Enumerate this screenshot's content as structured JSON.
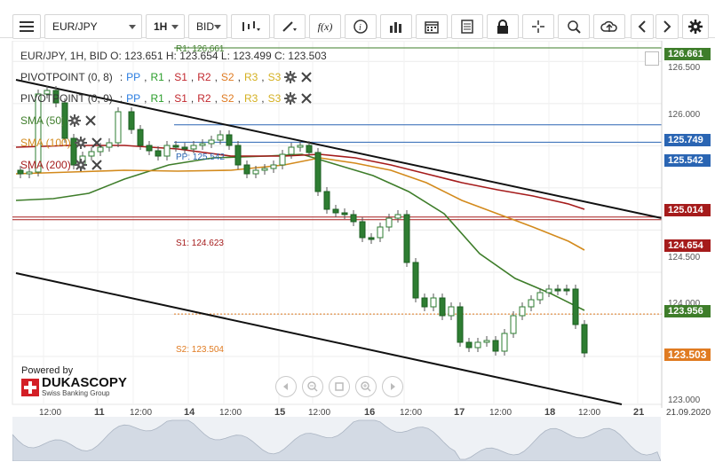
{
  "toolbar": {
    "menu_icon": "hamburger-icon",
    "instrument": "EUR/JPY",
    "timeframe": "1H",
    "side": "BID",
    "buttons": [
      "chart-type-icon",
      "draw-line-icon",
      "formula-icon",
      "info-icon",
      "indicators-icon",
      "calendar-icon",
      "news-icon",
      "lock-icon",
      "crosshair-icon",
      "zoom-icon",
      "cloud-upload-icon",
      "prev-icon",
      "next-icon",
      "settings-icon"
    ],
    "formula_label": "f(x)"
  },
  "legend": {
    "ohlc": "EUR/JPY, 1H, BID   O: 123.651 H: 123.654 L: 123.499 C: 123.503",
    "pivot1": {
      "name": "PIVOTPOINT (0, 8)",
      "sep": ":",
      "items": [
        "PP",
        "R1",
        "S1",
        "R2",
        "S2",
        "R3",
        "S3"
      ]
    },
    "pivot2": {
      "name": "PIVOTPOINT (0, 9)",
      "sep": ":",
      "items": [
        "PP",
        "R1",
        "S1",
        "R2",
        "S2",
        "R3",
        "S3"
      ]
    },
    "sma50": "SMA (50)",
    "sma100": "SMA (100)",
    "sma200": "SMA (200)",
    "pivot_colors": [
      "#2a7de1",
      "#2a9d2a",
      "#c1272d",
      "#c1272d",
      "#d4a020",
      "#d4a020",
      "#d4a020"
    ]
  },
  "price_axis": {
    "ticks": [
      "126.500",
      "126.000",
      "124.500",
      "124.000",
      "123.000"
    ],
    "labels": [
      {
        "value": "126.661",
        "color": "#3e7d2a"
      },
      {
        "value": "125.749",
        "color": "#2a65b3"
      },
      {
        "value": "125.542",
        "color": "#2a65b3"
      },
      {
        "value": "125.014",
        "color": "#a51b1b"
      },
      {
        "value": "124.654",
        "color": "#a51b1b"
      },
      {
        "value": "123.956",
        "color": "#3e7d2a"
      },
      {
        "value": "123.503",
        "color": "#e07b21"
      }
    ]
  },
  "levels": {
    "r1": "R1: 126.661",
    "s1": "S1: 124.623",
    "s2": "S2: 123.504",
    "pp": "PP: 125.542"
  },
  "time_axis": {
    "labels": [
      {
        "t": "12:00",
        "b": false
      },
      {
        "t": "11",
        "b": true
      },
      {
        "t": "12:00",
        "b": false
      },
      {
        "t": "14",
        "b": true
      },
      {
        "t": "12:00",
        "b": false
      },
      {
        "t": "15",
        "b": true
      },
      {
        "t": "12:00",
        "b": false
      },
      {
        "t": "16",
        "b": true
      },
      {
        "t": "12:00",
        "b": false
      },
      {
        "t": "17",
        "b": true
      },
      {
        "t": "12:00",
        "b": false
      },
      {
        "t": "18",
        "b": true
      },
      {
        "t": "12:00",
        "b": false
      },
      {
        "t": "21",
        "b": true
      },
      {
        "t": "21.09.2020",
        "b": false
      }
    ]
  },
  "branding": {
    "powered": "Powered by",
    "name": "DUKASCOPY",
    "sub": "Swiss Banking Group"
  },
  "nav_icons": [
    "scroll-left-icon",
    "zoom-out-icon",
    "reset-zoom-icon",
    "zoom-in-icon",
    "scroll-right-icon"
  ]
}
